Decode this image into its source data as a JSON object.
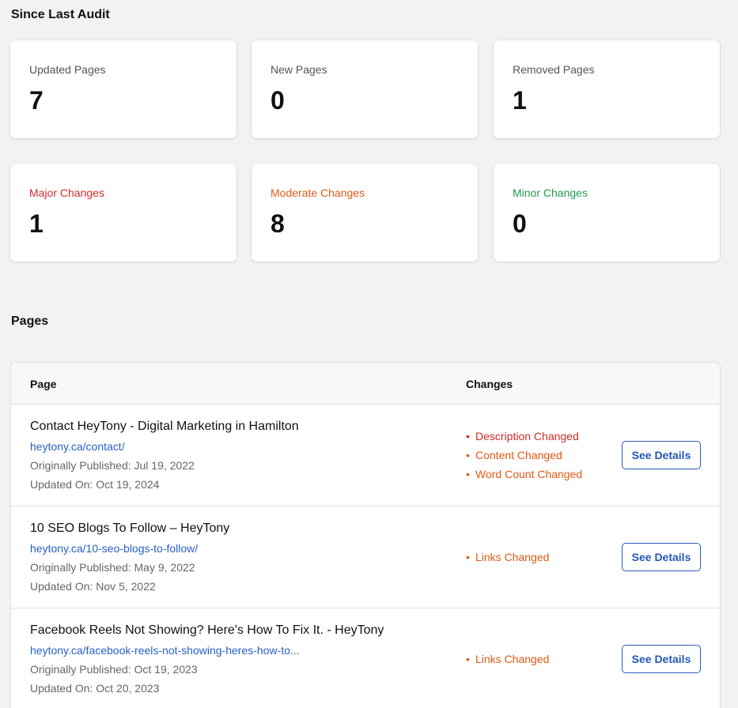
{
  "since_last_audit": {
    "title": "Since Last Audit",
    "cards": [
      {
        "label": "Updated Pages",
        "value": "7",
        "color": "#555555"
      },
      {
        "label": "New Pages",
        "value": "0",
        "color": "#555555"
      },
      {
        "label": "Removed Pages",
        "value": "1",
        "color": "#555555"
      },
      {
        "label": "Major Changes",
        "value": "1",
        "color": "#d12b2b"
      },
      {
        "label": "Moderate Changes",
        "value": "8",
        "color": "#e05a14"
      },
      {
        "label": "Minor Changes",
        "value": "0",
        "color": "#1f9d4f"
      }
    ]
  },
  "pages": {
    "title": "Pages",
    "columns": {
      "page": "Page",
      "changes": "Changes"
    },
    "published_label": "Originally Published:",
    "updated_label": "Updated On:",
    "button_label": "See Details",
    "rows": [
      {
        "title": "Contact HeyTony - Digital Marketing in Hamilton",
        "url": "heytony.ca/contact/",
        "published": "Jul 19, 2022",
        "updated": "Oct 19, 2024",
        "changes": [
          {
            "text": "Description Changed",
            "color": "#d12b2b"
          },
          {
            "text": "Content Changed",
            "color": "#e05a14"
          },
          {
            "text": "Word Count Changed",
            "color": "#e05a14"
          }
        ]
      },
      {
        "title": "10 SEO Blogs To Follow – HeyTony",
        "url": "heytony.ca/10-seo-blogs-to-follow/",
        "published": "May 9, 2022",
        "updated": "Nov 5, 2022",
        "changes": [
          {
            "text": "Links Changed",
            "color": "#e05a14"
          }
        ]
      },
      {
        "title": "Facebook Reels Not Showing? Here's How To Fix It. - HeyTony",
        "url": "heytony.ca/facebook-reels-not-showing-heres-how-to...",
        "published": "Oct 19, 2023",
        "updated": "Oct 20, 2023",
        "changes": [
          {
            "text": "Links Changed",
            "color": "#e05a14"
          }
        ]
      }
    ]
  },
  "bullet": "•"
}
